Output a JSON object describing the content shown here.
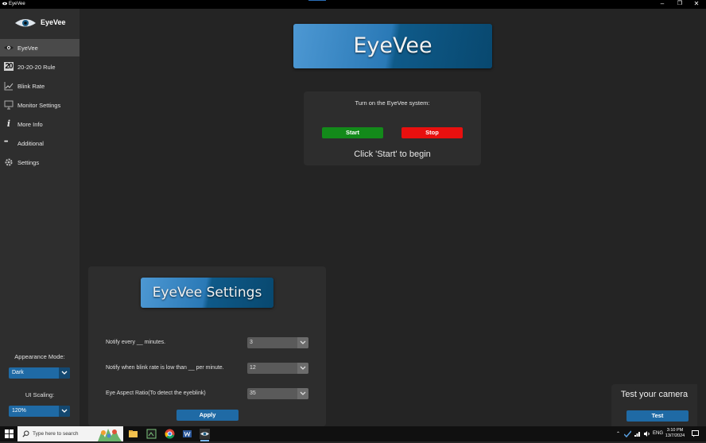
{
  "window": {
    "title": "EyeVee",
    "controls": [
      "–",
      "❐",
      "✕"
    ]
  },
  "sidebar": {
    "logo_text": "EyeVee",
    "items": [
      {
        "label": "EyeVee",
        "icon": "eye-icon",
        "active": true
      },
      {
        "label": "20-20-20 Rule",
        "icon": "number-20-icon",
        "icon_text": "20"
      },
      {
        "label": "Blink Rate",
        "icon": "line-chart-icon"
      },
      {
        "label": "Monitor Settings",
        "icon": "monitor-icon"
      },
      {
        "label": "More Info",
        "icon": "info-icon",
        "icon_text": "i"
      },
      {
        "label": "Additional",
        "icon": "more-dots-icon",
        "icon_text": "•••"
      },
      {
        "label": "Settings",
        "icon": "gear-icon"
      }
    ],
    "appearance": {
      "label": "Appearance Mode:",
      "value": "Dark"
    },
    "scaling": {
      "label": "UI Scaling:",
      "value": "120%"
    }
  },
  "main": {
    "banner": "EyeVee",
    "control": {
      "title": "Turn on the EyeVee system:",
      "start_label": "Start",
      "stop_label": "Stop",
      "status": "Click 'Start' to begin"
    }
  },
  "settings": {
    "banner": "EyeVee Settings",
    "fields": [
      {
        "label": "Notify every __ minutes.",
        "value": "3"
      },
      {
        "label": "Notify when blink rate is low than __ per minute.",
        "value": "12"
      },
      {
        "label": "Eye Aspect Ratio(To detect the eyeblink)",
        "value": "35"
      }
    ],
    "apply_label": "Apply"
  },
  "camera": {
    "title": "Test your camera",
    "button_label": "Test"
  },
  "taskbar": {
    "search_placeholder": "Type here to search",
    "tray": {
      "language": "ENG",
      "time": "3:10 PM",
      "date": "13/7/2024"
    }
  },
  "colors": {
    "accent": "#1f6aa5",
    "start": "#138a1a",
    "stop": "#e8100f",
    "background": "#242424",
    "sidebar": "#2e2e2e"
  }
}
